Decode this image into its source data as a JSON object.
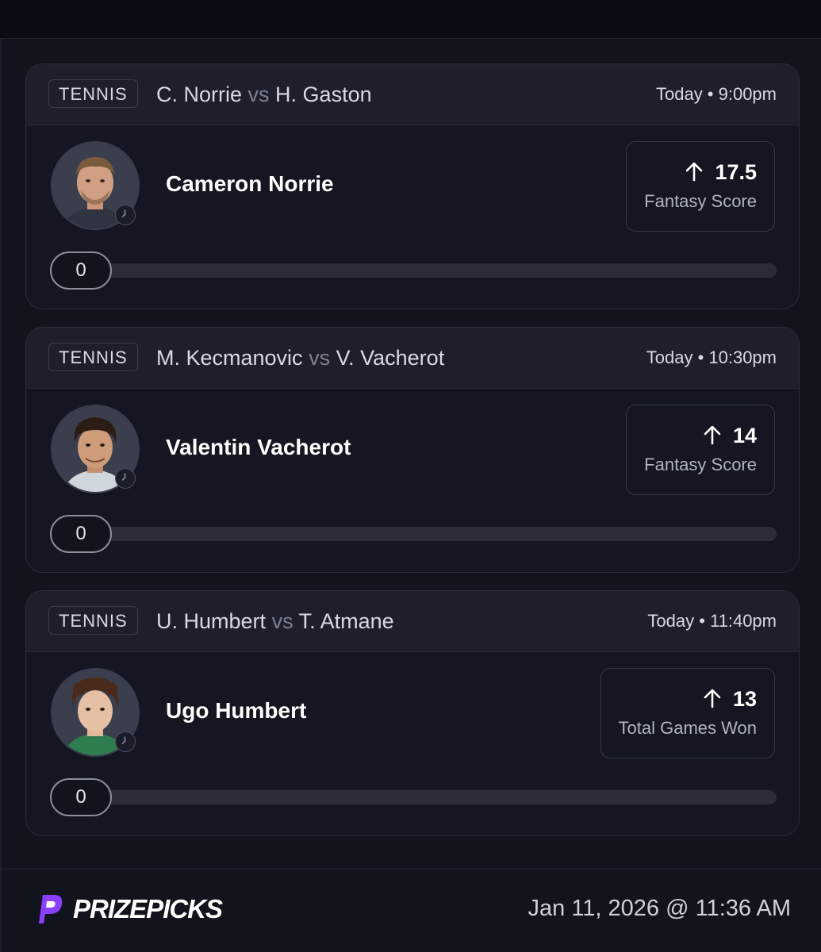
{
  "cards": [
    {
      "sport": "TENNIS",
      "player1": "C. Norrie",
      "vs": "vs",
      "player2": "H. Gaston",
      "time": "Today • 9:00pm",
      "player_name": "Cameron Norrie",
      "line": "17.5",
      "stat": "Fantasy Score",
      "progress_value": "0",
      "progress_fraction": 0
    },
    {
      "sport": "TENNIS",
      "player1": "M. Kecmanovic",
      "vs": "vs",
      "player2": "V. Vacherot",
      "time": "Today • 10:30pm",
      "player_name": "Valentin Vacherot",
      "line": "14",
      "stat": "Fantasy Score",
      "progress_value": "0",
      "progress_fraction": 0
    },
    {
      "sport": "TENNIS",
      "player1": "U. Humbert",
      "vs": "vs",
      "player2": "T. Atmane",
      "time": "Today • 11:40pm",
      "player_name": "Ugo Humbert",
      "line": "13",
      "stat": "Total Games Won",
      "progress_value": "0",
      "progress_fraction": 0
    }
  ],
  "footer": {
    "brand": "PRIZEPICKS",
    "timestamp": "Jan 11, 2026 @ 11:36 AM"
  },
  "icons": {
    "direction": "up-arrow-icon",
    "status": "clock-icon",
    "logo": "prizepicks-logo-icon"
  },
  "colors": {
    "background": "#12141d",
    "card": "#141722",
    "card_header": "#1d1f2b",
    "brand_purple": "#8a3ffc"
  }
}
